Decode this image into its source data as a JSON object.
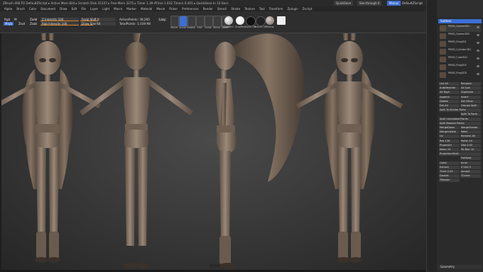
{
  "titlebar": {
    "text": "ZBrush 4R6 P2   DefaultZScript  ▸ Active Mem 824 ▸ Scratch Disk 21337 ▸ Free Mem 3275 ▸ Timer 1.49 ATime 1.632 Timers 0.401 ▸ QuickSave In 10 Secs"
  },
  "top_right": {
    "quicksave": "QuickSave",
    "see_through": "See-through 0",
    "menus": "Menus",
    "default_script": "DefaultZScript"
  },
  "menu": [
    "Alpha",
    "Brush",
    "Color",
    "Document",
    "Draw",
    "Edit",
    "File",
    "Layer",
    "Light",
    "Macro",
    "Marker",
    "Material",
    "Movie",
    "Picker",
    "Preferences",
    "Render",
    "Stencil",
    "Stroke",
    "Texture",
    "Tool",
    "Transform",
    "Zplugin",
    "Zscript"
  ],
  "toolbar": {
    "rgb": "Rgb",
    "m": "M",
    "zadd": "Zadd",
    "zsub": "Zsub",
    "mrgb": "Mrgb",
    "zcut": "Zcut",
    "rgb_intensity": "Rgb Intensity 100",
    "z_intensity": "Z Intensity 100",
    "focal_shift": "Focal Shift 0",
    "draw_size": "Draw Size 64",
    "active_points": "ActivePoints: 38,265",
    "total_points": "TotalPoints: 1.019 Mil",
    "lazy": "Lazy",
    "icons": [
      "Move",
      "Scale",
      "Rotate",
      "Edit",
      "Draw",
      "Move",
      "Zoom"
    ],
    "sphere_labels": [
      "Standard",
      "DragRect",
      "Alpha Off",
      "Texture Off",
      "Matcap"
    ],
    "accent": "#e08a2a",
    "highlight": "#3c6fd6"
  },
  "panel": {
    "subtool_title": "Subtool",
    "subtools": [
      "PM3D_Sphere3D1",
      "PM3D_Sphere3D2",
      "PM3D_Ring3D1",
      "PM3D_Cylinder3D1",
      "PM3D_Cube3D1",
      "PM3D_Ring3D2",
      "PM3D_Ring3D3"
    ],
    "buttons": [
      "List All",
      "Rename",
      "AutoReorder",
      "All Low",
      "All High",
      "Duplicate",
      "Append",
      "Insert",
      "Delete",
      "Del Other",
      "Del All",
      "Groups Split",
      "Split To Similar Parts",
      "Split To Parts",
      "Split Unmasked Points",
      "Split Masked Points",
      "MergeDown",
      "MergeSimilar",
      "MergeVisible",
      "Weld",
      "Uv",
      "Remesh All",
      "Res 128",
      "Polish 10",
      "ProjectAll",
      "Dist 0.02",
      "Mean 25",
      "PA Blur 10",
      "ProjectionShell",
      "Farthest",
      "Outer",
      "Inner",
      "Extract",
      "S Smt 5",
      "Thick 0.02",
      "Accept",
      "Double",
      "TCorne",
      "TBorder"
    ],
    "footer": "Geometry"
  }
}
